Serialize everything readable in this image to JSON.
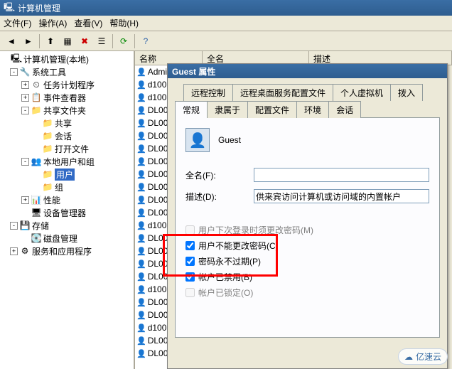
{
  "window": {
    "title": "计算机管理"
  },
  "menu": {
    "file": "文件(F)",
    "action": "操作(A)",
    "view": "查看(V)",
    "help": "帮助(H)"
  },
  "tree": {
    "root": "计算机管理(本地)",
    "system_tools": "系统工具",
    "task_scheduler": "任务计划程序",
    "event_viewer": "事件查看器",
    "shared_folders": "共享文件夹",
    "shares": "共享",
    "sessions": "会话",
    "open_files": "打开文件",
    "local_users_groups": "本地用户和组",
    "users": "用户",
    "groups": "组",
    "performance": "性能",
    "device_manager": "设备管理器",
    "storage": "存储",
    "disk_management": "磁盘管理",
    "services_apps": "服务和应用程序"
  },
  "list": {
    "col_name": "名称",
    "col_fullname": "全名",
    "col_desc": "描述",
    "rows": [
      "Admi",
      "d100",
      "d100",
      "DL00",
      "DL00",
      "DL00",
      "DL00",
      "DL00",
      "DL00",
      "DL00",
      "DL00",
      "DL00",
      "d100",
      "DL00",
      "DL00",
      "DL00",
      "DL00",
      "d100",
      "DL00",
      "DL00",
      "d100",
      "DL00",
      "DL00"
    ]
  },
  "dialog": {
    "title": "Guest 属性",
    "tabs_row1": {
      "remote_control": "远程控制",
      "rds_profile": "远程桌面服务配置文件",
      "personal_vm": "个人虚拟机",
      "dialin": "拨入"
    },
    "tabs_row2": {
      "general": "常规",
      "member_of": "隶属于",
      "profile": "配置文件",
      "environment": "环境",
      "sessions": "会话"
    },
    "account_name": "Guest",
    "fullname_label": "全名(F):",
    "fullname_value": "",
    "desc_label": "描述(D):",
    "desc_value": "供来宾访问计算机或访问域的内置帐户",
    "chk_must_change": "用户下次登录时须更改密码(M)",
    "chk_cannot_change": "用户不能更改密码(C)",
    "chk_never_expires": "密码永不过期(P)",
    "chk_disabled": "帐户已禁用(B)",
    "chk_locked": "帐户已锁定(O)"
  },
  "watermark": "亿速云"
}
